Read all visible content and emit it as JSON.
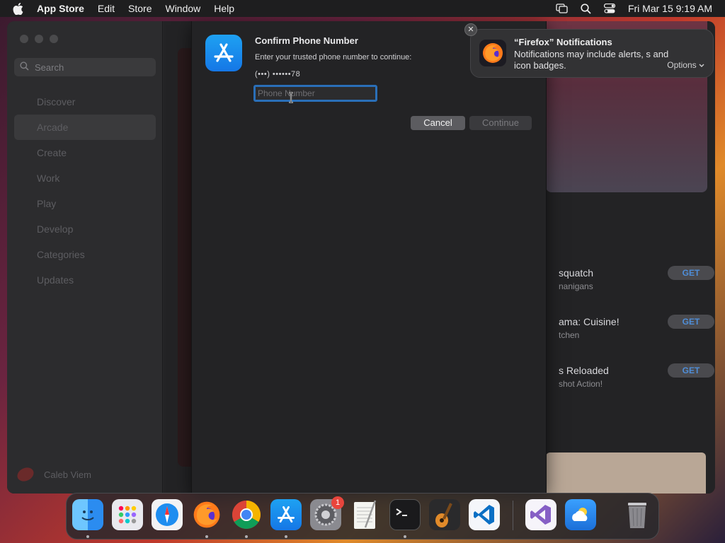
{
  "menubar": {
    "app_name": "App Store",
    "items": [
      "Edit",
      "Store",
      "Window",
      "Help"
    ],
    "datetime": "Fri Mar 15  9:19 AM"
  },
  "sidebar": {
    "search_placeholder": "Search",
    "items": [
      {
        "label": "Discover",
        "active": false
      },
      {
        "label": "Arcade",
        "active": true
      },
      {
        "label": "Create",
        "active": false
      },
      {
        "label": "Work",
        "active": false
      },
      {
        "label": "Play",
        "active": false
      },
      {
        "label": "Develop",
        "active": false
      },
      {
        "label": "Categories",
        "active": false
      },
      {
        "label": "Updates",
        "active": false
      }
    ],
    "user_name": "Caleb Viem"
  },
  "games": [
    {
      "title": "squatch",
      "subtitle": "nanigans",
      "button": "GET"
    },
    {
      "title": "ama: Cuisine!",
      "subtitle": "tchen",
      "button": "GET"
    },
    {
      "title": "s Reloaded",
      "subtitle": "shot Action!",
      "button": "GET"
    }
  ],
  "dialog": {
    "title": "Confirm Phone Number",
    "message": "Enter your trusted phone number to continue:",
    "masked_number": "(•••) ••••••78",
    "input_placeholder": "Phone Number",
    "input_value": "",
    "cancel_label": "Cancel",
    "continue_label": "Continue",
    "continue_enabled": false
  },
  "notification": {
    "close_label": "✕",
    "title": "“Firefox” Notifications",
    "body": "Notifications may include alerts, s and icon badges.",
    "options_label": "Options"
  },
  "dock": {
    "apps": [
      "Finder",
      "Launchpad",
      "Safari",
      "Firefox",
      "Chrome",
      "App Store",
      "System Settings",
      "TextEdit",
      "Terminal",
      "GarageBand",
      "Visual Studio Code",
      "Visual Studio",
      "Weather",
      "Trash"
    ],
    "settings_badge": "1"
  }
}
